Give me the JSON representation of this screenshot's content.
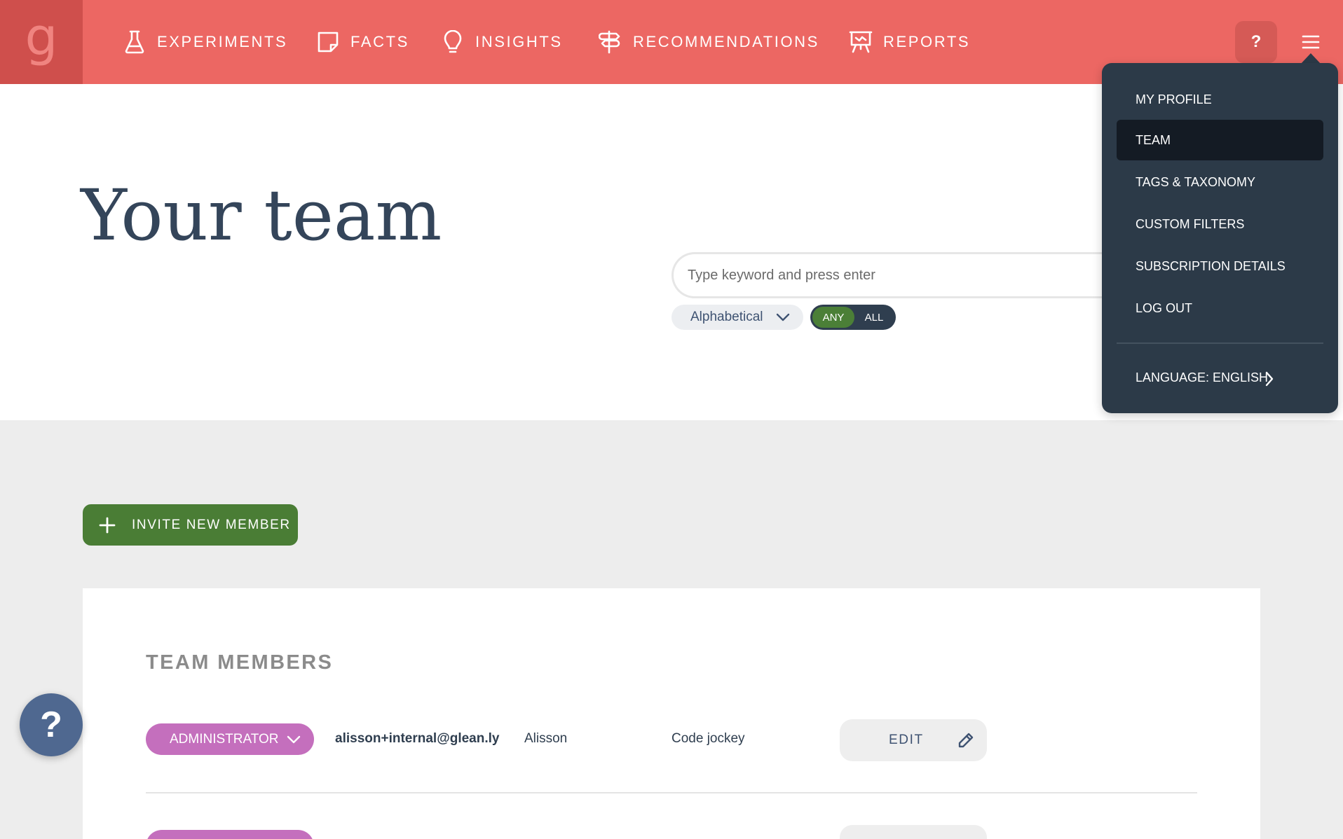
{
  "logo": {
    "glyph": "g"
  },
  "nav": {
    "items": [
      {
        "label": "EXPERIMENTS",
        "icon": "flask-icon"
      },
      {
        "label": "FACTS",
        "icon": "note-icon"
      },
      {
        "label": "INSIGHTS",
        "icon": "lightbulb-icon"
      },
      {
        "label": "RECOMMENDATIONS",
        "icon": "signpost-icon"
      },
      {
        "label": "REPORTS",
        "icon": "presentation-icon"
      }
    ],
    "help_label": "?",
    "menu_icon": "hamburger-icon"
  },
  "page": {
    "title": "Your team"
  },
  "search": {
    "placeholder": "Type keyword and press enter"
  },
  "filters": {
    "sort_value": "Alphabetical",
    "match_options": [
      "ANY",
      "ALL"
    ],
    "match_selected": "ANY"
  },
  "actions": {
    "invite_label": "INVITE NEW MEMBER"
  },
  "team": {
    "section_title": "TEAM MEMBERS",
    "members": [
      {
        "role": "ADMINISTRATOR",
        "email": "alisson+internal@glean.ly",
        "name": "Alisson",
        "job": "Code jockey",
        "edit_label": "EDIT"
      }
    ]
  },
  "floating_help": {
    "label": "?"
  },
  "menu": {
    "items": [
      {
        "label": "MY PROFILE",
        "active": false
      },
      {
        "label": "TEAM",
        "active": true
      },
      {
        "label": "TAGS & TAXONOMY",
        "active": false
      },
      {
        "label": "CUSTOM FILTERS",
        "active": false
      },
      {
        "label": "SUBSCRIPTION DETAILS",
        "active": false
      },
      {
        "label": "LOG OUT",
        "active": false
      }
    ],
    "language_label": "LANGUAGE: ENGLISH"
  },
  "colors": {
    "header": "#ec6763",
    "logo_bg": "#cf4f4c",
    "primary_green": "#4a7d35",
    "role_pill": "#c46fbd",
    "menu_bg": "#2c3a48",
    "menu_active": "#141b24",
    "help_fab": "#4f6890"
  }
}
